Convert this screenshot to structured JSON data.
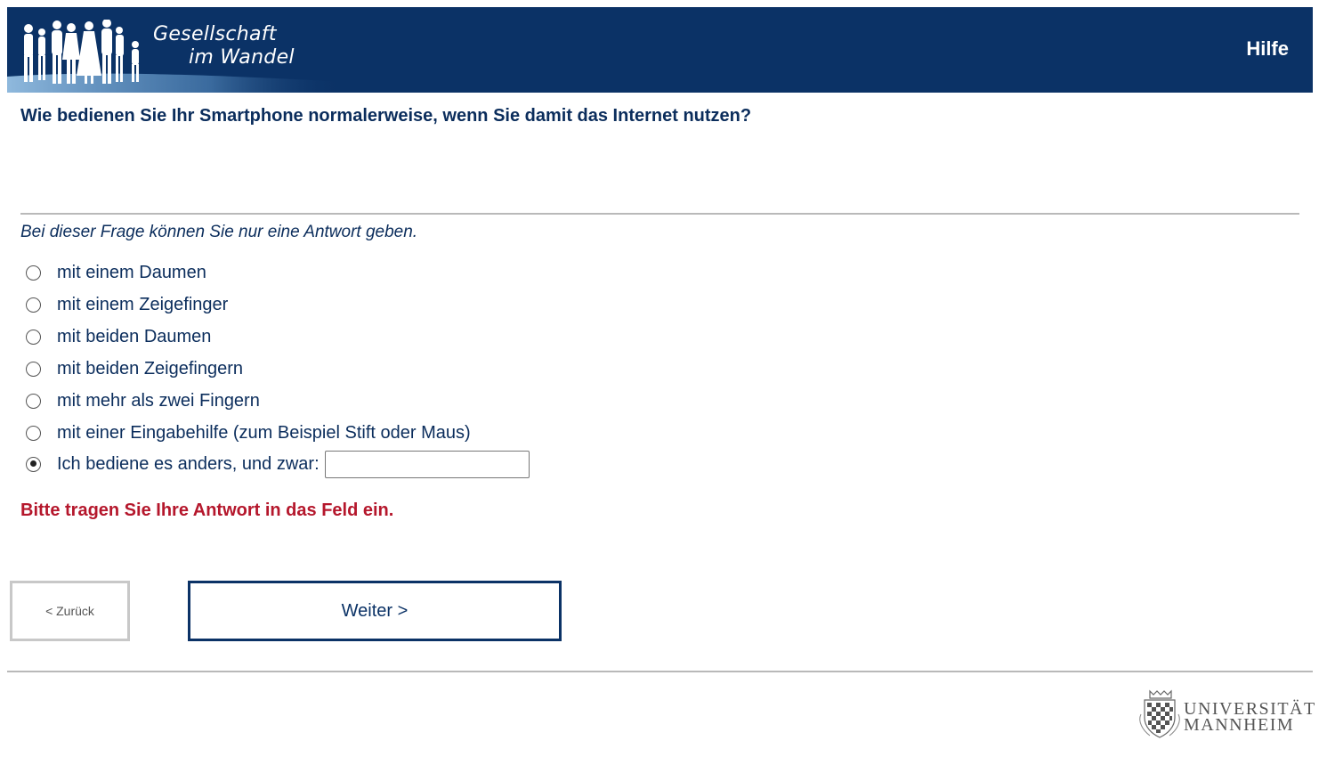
{
  "header": {
    "logo_line1": "Gesellschaft",
    "logo_line2": "im Wandel",
    "help_label": "Hilfe",
    "background_color": "#0b3266"
  },
  "question": {
    "text": "Wie bedienen Sie Ihr Smartphone normalerweise, wenn Sie damit das Internet nutzen?",
    "hint": "Bei dieser Frage können Sie nur eine Antwort geben."
  },
  "options": [
    {
      "label": "mit einem Daumen",
      "selected": false
    },
    {
      "label": "mit einem Zeigefinger",
      "selected": false
    },
    {
      "label": "mit beiden Daumen",
      "selected": false
    },
    {
      "label": "mit beiden Zeigefingern",
      "selected": false
    },
    {
      "label": "mit mehr als zwei Fingern",
      "selected": false
    },
    {
      "label": "mit einer Eingabehilfe (zum Beispiel Stift oder Maus)",
      "selected": false
    },
    {
      "label": "Ich bediene es anders, und zwar:",
      "selected": true,
      "input_value": ""
    }
  ],
  "error_message": "Bitte tragen Sie Ihre Antwort in das Feld ein.",
  "navigation": {
    "back_label": "< Zurück",
    "next_label": "Weiter >"
  },
  "footer": {
    "university_line1": "UNIVERSITÄT",
    "university_line2": "MANNHEIM"
  },
  "colors": {
    "text": "#0b2d5c",
    "error": "#b5172c",
    "accent": "#0b3266"
  }
}
